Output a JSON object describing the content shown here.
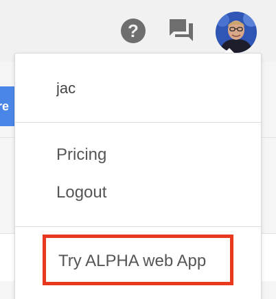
{
  "header": {
    "help_icon": "help-circle-icon",
    "help_glyph": "?",
    "feedback_icon": "feedback-chat-icon",
    "avatar_icon": "user-avatar"
  },
  "background": {
    "button_partial_label": "are"
  },
  "menu": {
    "username": "jac",
    "items": [
      {
        "label": "Pricing"
      },
      {
        "label": "Logout"
      }
    ],
    "alpha_label": "Try ALPHA web App",
    "highlight_color": "#e8391f"
  }
}
